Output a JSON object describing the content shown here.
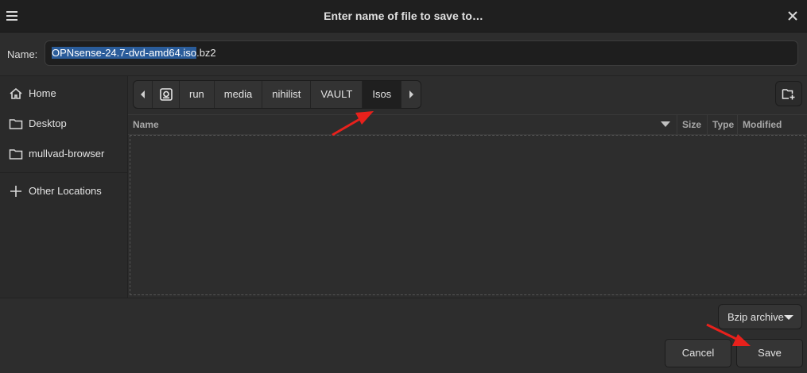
{
  "dialog": {
    "title": "Enter name of file to save to…"
  },
  "name_field": {
    "label": "Name:",
    "value_selected": "OPNsense-24.7-dvd-amd64.iso",
    "value_rest": ".bz2"
  },
  "sidebar": {
    "items": [
      {
        "label": "Home",
        "icon": "home-icon"
      },
      {
        "label": "Desktop",
        "icon": "folder-icon"
      },
      {
        "label": "mullvad-browser",
        "icon": "folder-icon"
      },
      {
        "label": "Other Locations",
        "icon": "plus-icon"
      }
    ]
  },
  "pathbar": {
    "crumbs": [
      "run",
      "media",
      "nihilist",
      "VAULT",
      "Isos"
    ],
    "active": "Isos"
  },
  "columns": {
    "name": "Name",
    "size": "Size",
    "type": "Type",
    "modified": "Modified"
  },
  "filter": {
    "selected": "Bzip archive"
  },
  "buttons": {
    "cancel": "Cancel",
    "save": "Save"
  },
  "colors": {
    "background": "#2d2d2d",
    "titlebar": "#1f1f1f",
    "selection": "#2a5c9a",
    "annotation_arrow": "#e8211c"
  }
}
